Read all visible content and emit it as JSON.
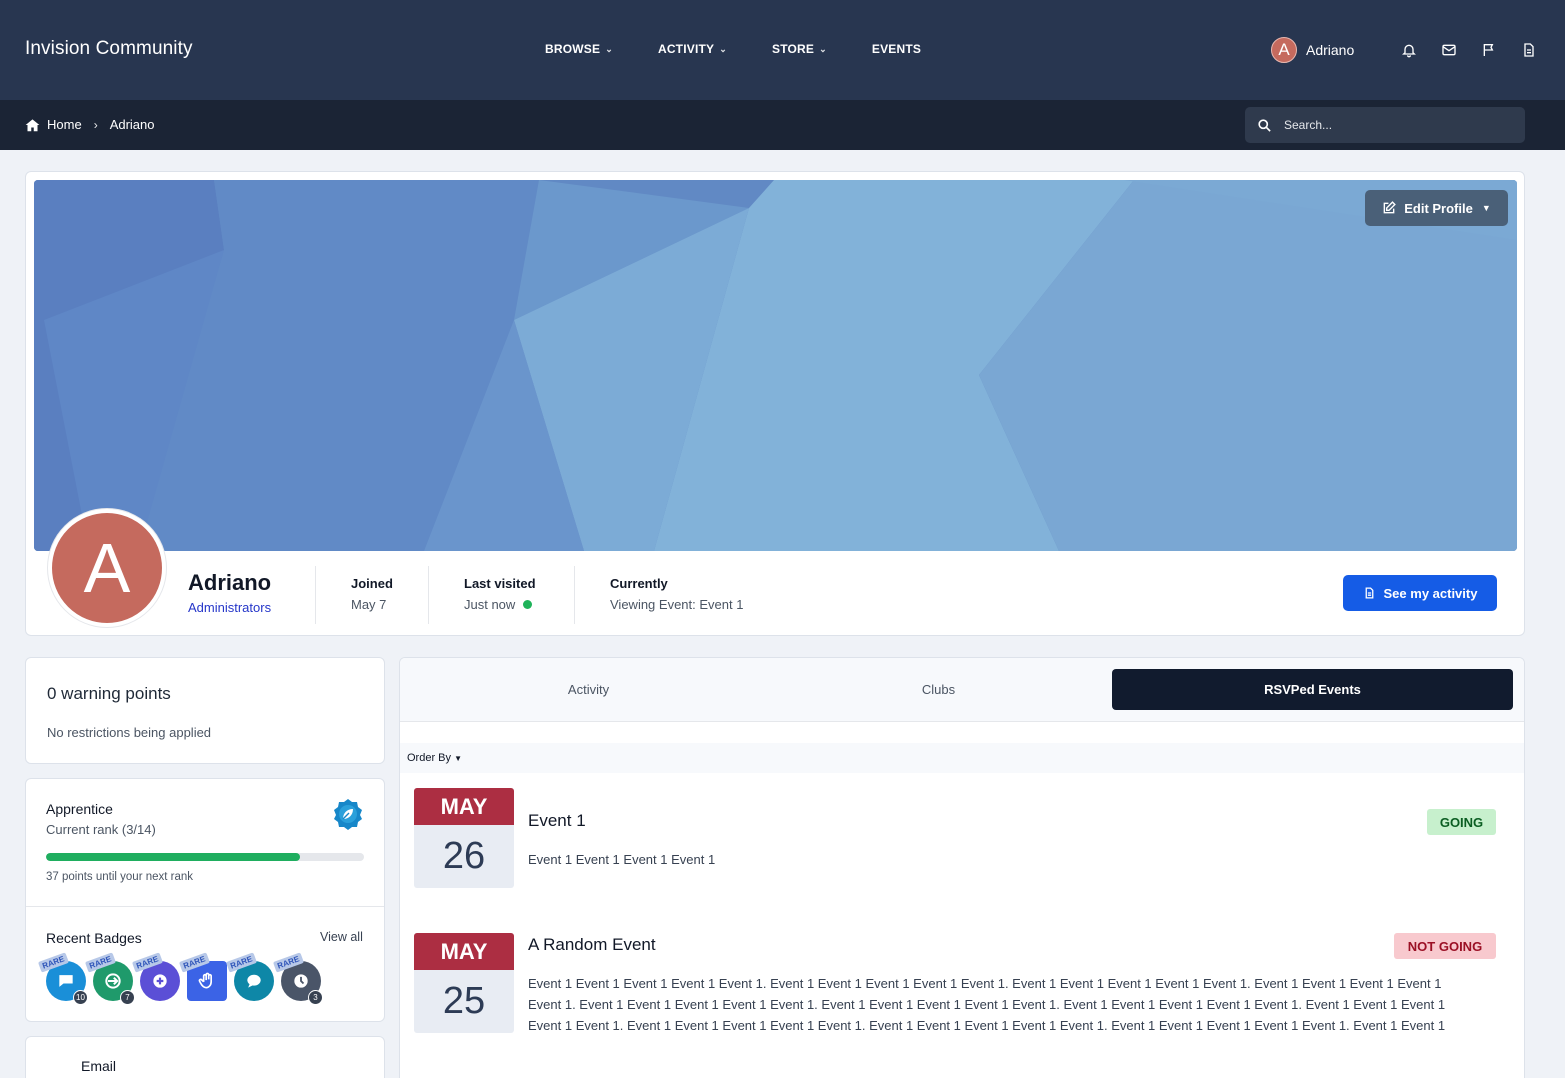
{
  "header": {
    "brand": "Invision Community",
    "nav": [
      {
        "label": "BROWSE",
        "has_menu": true
      },
      {
        "label": "ACTIVITY",
        "has_menu": true
      },
      {
        "label": "STORE",
        "has_menu": true
      },
      {
        "label": "EVENTS",
        "has_menu": false
      }
    ],
    "user": {
      "initial": "A",
      "name": "Adriano"
    },
    "icons": [
      "bell-icon",
      "envelope-icon",
      "flag-icon",
      "document-icon"
    ]
  },
  "breadcrumb": {
    "home": "Home",
    "current": "Adriano"
  },
  "search": {
    "placeholder": "Search..."
  },
  "profile": {
    "initial": "A",
    "name": "Adriano",
    "group": "Administrators",
    "edit_label": "Edit Profile",
    "joined_label": "Joined",
    "joined_value": "May 7",
    "last_visited_label": "Last visited",
    "last_visited_value": "Just now",
    "currently_label": "Currently",
    "currently_value": "Viewing Event: Event 1",
    "see_activity_label": "See my activity"
  },
  "warnings": {
    "title": "0 warning points",
    "subtitle": "No restrictions being applied"
  },
  "rank": {
    "title": "Apprentice",
    "subtitle": "Current rank (3/14)",
    "progress_fraction": 0.8,
    "next": "37 points until your next rank"
  },
  "badges": {
    "title": "Recent Badges",
    "view_all": "View all",
    "rare_label": "RARE",
    "items": [
      {
        "icon": "speech-bubble-icon",
        "color": "#1a8fd8",
        "count": "10"
      },
      {
        "icon": "arrow-enter-icon",
        "color": "#1f9a6b",
        "count": "7"
      },
      {
        "icon": "plus-circle-icon",
        "color": "#5b4fd6",
        "count": ""
      },
      {
        "icon": "waving-hand-icon",
        "color": "#3b63e6",
        "count": ""
      },
      {
        "icon": "chat-bubble-icon",
        "color": "#0e87a7",
        "count": ""
      },
      {
        "icon": "clock-icon",
        "color": "#4a5568",
        "count": "3"
      }
    ]
  },
  "email_panel": {
    "label": "Email"
  },
  "tabs": [
    {
      "label": "Activity",
      "active": false
    },
    {
      "label": "Clubs",
      "active": false
    },
    {
      "label": "RSVPed Events",
      "active": true
    }
  ],
  "order_by": "Order By",
  "events": [
    {
      "month": "MAY",
      "day": "26",
      "title": "Event 1",
      "status": "GOING",
      "description": "Event 1 Event 1 Event 1 Event 1"
    },
    {
      "month": "MAY",
      "day": "25",
      "title": "A Random Event",
      "status": "NOT GOING",
      "description": "Event 1 Event 1 Event 1 Event 1 Event 1. Event 1 Event 1 Event 1 Event 1 Event 1. Event 1 Event 1 Event 1 Event 1 Event 1. Event 1 Event 1 Event 1 Event 1 Event 1. Event 1 Event 1 Event 1 Event 1 Event 1. Event 1 Event 1 Event 1 Event 1 Event 1. Event 1 Event 1 Event 1 Event 1 Event 1. Event 1 Event 1 Event 1 Event 1 Event 1. Event 1 Event 1 Event 1 Event 1 Event 1. Event 1 Event 1 Event 1 Event 1 Event 1. Event 1 Event 1 Event 1 Event 1 Event 1. Event 1 Event 1 Event 1 Event 1 Event 1. Event 1 Event 1..."
    }
  ],
  "colors": {
    "topbar": "#283650",
    "subbar": "#1b2435",
    "primary_button": "#155ce6",
    "month_header": "#ac2e42",
    "online": "#1fb35a",
    "progress": "#1fae5f"
  }
}
